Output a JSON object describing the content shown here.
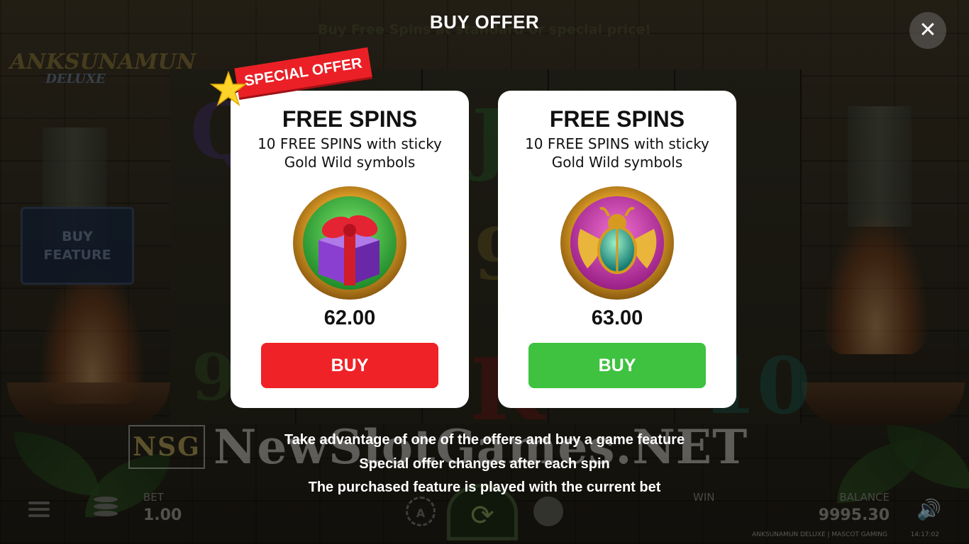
{
  "background": {
    "logo": {
      "line1": "ANKSUNAMUN",
      "line2": "DELUXE"
    },
    "buy_feature": {
      "line1": "BUY",
      "line2": "FEATURE"
    },
    "subtitle": "Buy Free Spins at standard or special price!"
  },
  "modal": {
    "title": "BUY OFFER",
    "close_icon": "close-icon",
    "special_badge": "SPECIAL OFFER",
    "offers": [
      {
        "title": "FREE SPINS",
        "description_line1": "10 FREE SPINS with sticky",
        "description_line2": "Gold Wild symbols",
        "icon": "gift-box-icon",
        "price": "62.00",
        "button_label": "BUY",
        "button_color": "#ee2227",
        "special": true
      },
      {
        "title": "FREE SPINS",
        "description_line1": "10 FREE SPINS with sticky",
        "description_line2": "Gold Wild symbols",
        "icon": "scarab-beetle-icon",
        "price": "63.00",
        "button_label": "BUY",
        "button_color": "#3ec240",
        "special": false
      }
    ],
    "info_lines": [
      "Take advantage of one of the offers and buy a game feature",
      "Special offer changes after each spin",
      "The purchased feature is played with the current bet"
    ]
  },
  "hud": {
    "bet_label": "BET",
    "bet_value": "1.00",
    "win_label": "WIN",
    "balance_label": "BALANCE",
    "balance_value": "9995.30",
    "footer": "ANKSUNAMUN DELUXE | MASCOT GAMING",
    "clock": "14:17:02"
  },
  "watermark": {
    "box": "NSG",
    "text": "NewSlotGames.NET"
  }
}
